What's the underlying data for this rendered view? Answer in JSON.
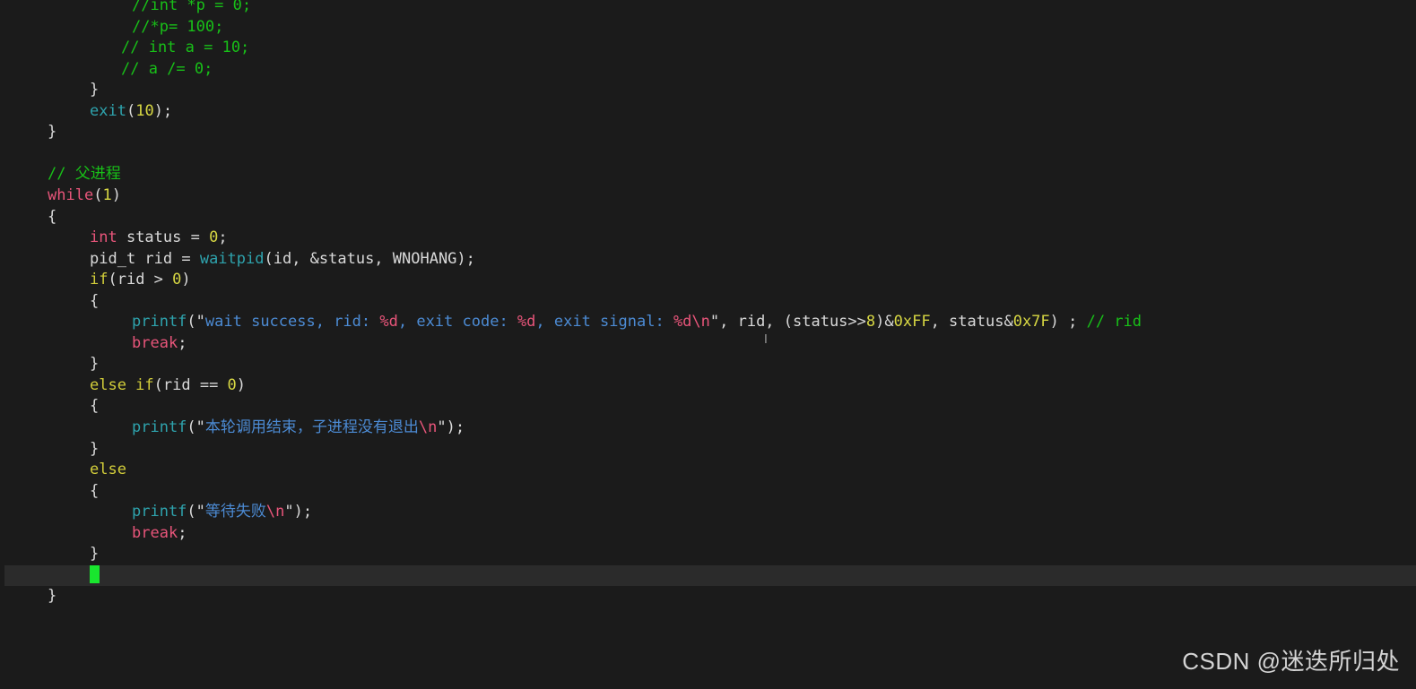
{
  "colors": {
    "background": "#1b1b1b",
    "cursorline": "#2b2b2b",
    "cursor": "#19e62e",
    "default": "#d9d9d9",
    "keyword": "#e8557a",
    "control": "#d2cd3a",
    "function": "#2ea3ad",
    "comment": "#18c018",
    "number": "#d7d743",
    "string": "#4c8bd4",
    "escape": "#e8557a"
  },
  "lines": [
    {
      "indent": 147,
      "tokens": [
        {
          "t": "//int *p = 0;",
          "k": "comment"
        }
      ]
    },
    {
      "indent": 147,
      "tokens": [
        {
          "t": "//*p= 100;",
          "k": "comment"
        }
      ]
    },
    {
      "indent": 135,
      "tokens": [
        {
          "t": "// int a = 10;",
          "k": "comment"
        }
      ]
    },
    {
      "indent": 135,
      "tokens": [
        {
          "t": "// a /= 0;",
          "k": "comment"
        }
      ]
    },
    {
      "indent": 100,
      "tokens": [
        {
          "t": "}",
          "k": "default"
        }
      ]
    },
    {
      "indent": 100,
      "tokens": [
        {
          "t": "exit",
          "k": "function"
        },
        {
          "t": "(",
          "k": "default"
        },
        {
          "t": "10",
          "k": "number"
        },
        {
          "t": ");",
          "k": "default"
        }
      ]
    },
    {
      "indent": 53,
      "tokens": [
        {
          "t": "}",
          "k": "default"
        }
      ]
    },
    {
      "indent": 53,
      "tokens": []
    },
    {
      "indent": 53,
      "tokens": [
        {
          "t": "// 父进程",
          "k": "comment"
        }
      ]
    },
    {
      "indent": 53,
      "tokens": [
        {
          "t": "while",
          "k": "keyword"
        },
        {
          "t": "(",
          "k": "default"
        },
        {
          "t": "1",
          "k": "number"
        },
        {
          "t": ")",
          "k": "default"
        }
      ]
    },
    {
      "indent": 53,
      "tokens": [
        {
          "t": "{",
          "k": "default"
        }
      ]
    },
    {
      "indent": 100,
      "tokens": [
        {
          "t": "int",
          "k": "keyword"
        },
        {
          "t": " status = ",
          "k": "default"
        },
        {
          "t": "0",
          "k": "number"
        },
        {
          "t": ";",
          "k": "default"
        }
      ]
    },
    {
      "indent": 100,
      "tokens": [
        {
          "t": "pid_t rid = ",
          "k": "default"
        },
        {
          "t": "waitpid",
          "k": "function"
        },
        {
          "t": "(id, &status, WNOHANG);",
          "k": "default"
        }
      ]
    },
    {
      "indent": 100,
      "tokens": [
        {
          "t": "if",
          "k": "control"
        },
        {
          "t": "(rid > ",
          "k": "default"
        },
        {
          "t": "0",
          "k": "number"
        },
        {
          "t": ")",
          "k": "default"
        }
      ]
    },
    {
      "indent": 100,
      "tokens": [
        {
          "t": "{",
          "k": "default"
        }
      ]
    },
    {
      "indent": 147,
      "tokens": [
        {
          "t": "printf",
          "k": "function"
        },
        {
          "t": "(\"",
          "k": "default"
        },
        {
          "t": "wait success, rid: ",
          "k": "string"
        },
        {
          "t": "%d",
          "k": "escape"
        },
        {
          "t": ", exit code: ",
          "k": "string"
        },
        {
          "t": "%d",
          "k": "escape"
        },
        {
          "t": ", exit signal: ",
          "k": "string"
        },
        {
          "t": "%d\\n",
          "k": "escape"
        },
        {
          "t": "\", rid, (status>>",
          "k": "default"
        },
        {
          "t": "8",
          "k": "number"
        },
        {
          "t": ")&",
          "k": "default"
        },
        {
          "t": "0xFF",
          "k": "number"
        },
        {
          "t": ", status&",
          "k": "default"
        },
        {
          "t": "0x7F",
          "k": "number"
        },
        {
          "t": ") ; ",
          "k": "default"
        },
        {
          "t": "// rid",
          "k": "comment"
        }
      ]
    },
    {
      "indent": 147,
      "tokens": [
        {
          "t": "break",
          "k": "keyword"
        },
        {
          "t": ";",
          "k": "default"
        }
      ]
    },
    {
      "indent": 100,
      "tokens": [
        {
          "t": "}",
          "k": "default"
        }
      ]
    },
    {
      "indent": 100,
      "tokens": [
        {
          "t": "else if",
          "k": "control"
        },
        {
          "t": "(rid == ",
          "k": "default"
        },
        {
          "t": "0",
          "k": "number"
        },
        {
          "t": ")",
          "k": "default"
        }
      ]
    },
    {
      "indent": 100,
      "tokens": [
        {
          "t": "{",
          "k": "default"
        }
      ]
    },
    {
      "indent": 147,
      "tokens": [
        {
          "t": "printf",
          "k": "function"
        },
        {
          "t": "(\"",
          "k": "default"
        },
        {
          "t": "本轮调用结束，子进程没有退出",
          "k": "string"
        },
        {
          "t": "\\n",
          "k": "escape"
        },
        {
          "t": "\");",
          "k": "default"
        }
      ]
    },
    {
      "indent": 100,
      "tokens": [
        {
          "t": "}",
          "k": "default"
        }
      ]
    },
    {
      "indent": 100,
      "tokens": [
        {
          "t": "else",
          "k": "control"
        }
      ]
    },
    {
      "indent": 100,
      "tokens": [
        {
          "t": "{",
          "k": "default"
        }
      ]
    },
    {
      "indent": 147,
      "tokens": [
        {
          "t": "printf",
          "k": "function"
        },
        {
          "t": "(\"",
          "k": "default"
        },
        {
          "t": "等待失败",
          "k": "string"
        },
        {
          "t": "\\n",
          "k": "escape"
        },
        {
          "t": "\");",
          "k": "default"
        }
      ]
    },
    {
      "indent": 147,
      "tokens": [
        {
          "t": "break",
          "k": "keyword"
        },
        {
          "t": ";",
          "k": "default"
        }
      ]
    },
    {
      "indent": 100,
      "tokens": [
        {
          "t": "}",
          "k": "default"
        }
      ]
    },
    {
      "indent": 100,
      "cursor": true,
      "tokens": []
    },
    {
      "indent": 53,
      "tokens": [
        {
          "t": "}",
          "k": "default"
        }
      ]
    }
  ],
  "watermark": "CSDN @迷迭所归处"
}
